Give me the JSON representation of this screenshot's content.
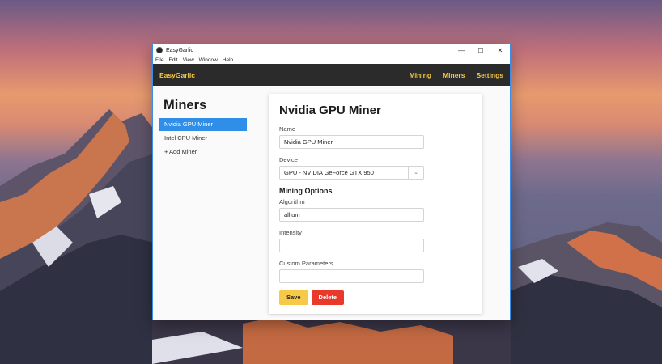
{
  "window": {
    "title": "EasyGarlic",
    "controls": [
      "—",
      "☐",
      "✕"
    ]
  },
  "menu": [
    "File",
    "Edit",
    "View",
    "Window",
    "Help"
  ],
  "navbar": {
    "brand": "EasyGarlic",
    "links": [
      "Mining",
      "Miners",
      "Settings"
    ],
    "accent_color": "#f7c948"
  },
  "sidebar": {
    "title": "Miners",
    "items": [
      {
        "label": "Nvidia GPU Miner",
        "active": true
      },
      {
        "label": "Intel CPU Miner",
        "active": false
      },
      {
        "label": "+ Add Miner",
        "active": false
      }
    ]
  },
  "form": {
    "title": "Nvidia GPU Miner",
    "name_label": "Name",
    "name_value": "Nvidia GPU Miner",
    "device_label": "Device",
    "device_value": "GPU - NVIDIA GeForce GTX 950",
    "options_title": "Mining Options",
    "algorithm_label": "Algorithm",
    "algorithm_value": "allium",
    "intensity_label": "Intensity",
    "intensity_value": "",
    "custom_label": "Custom Parameters",
    "custom_value": "",
    "save_label": "Save",
    "delete_label": "Delete"
  }
}
